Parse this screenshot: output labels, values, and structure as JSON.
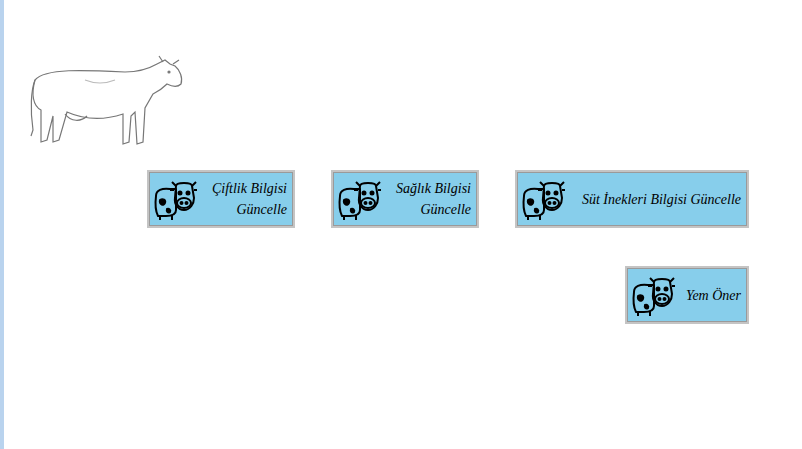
{
  "buttons": [
    {
      "label": "Çiftlik Bilgisi Güncelle",
      "row": 1
    },
    {
      "label": "Sağlık Bilgisi Güncelle",
      "row": 1
    },
    {
      "label": "Süt İnekleri Bilgisi Güncelle",
      "row": 1
    },
    {
      "label": "Yem Öner",
      "row": 2
    }
  ]
}
